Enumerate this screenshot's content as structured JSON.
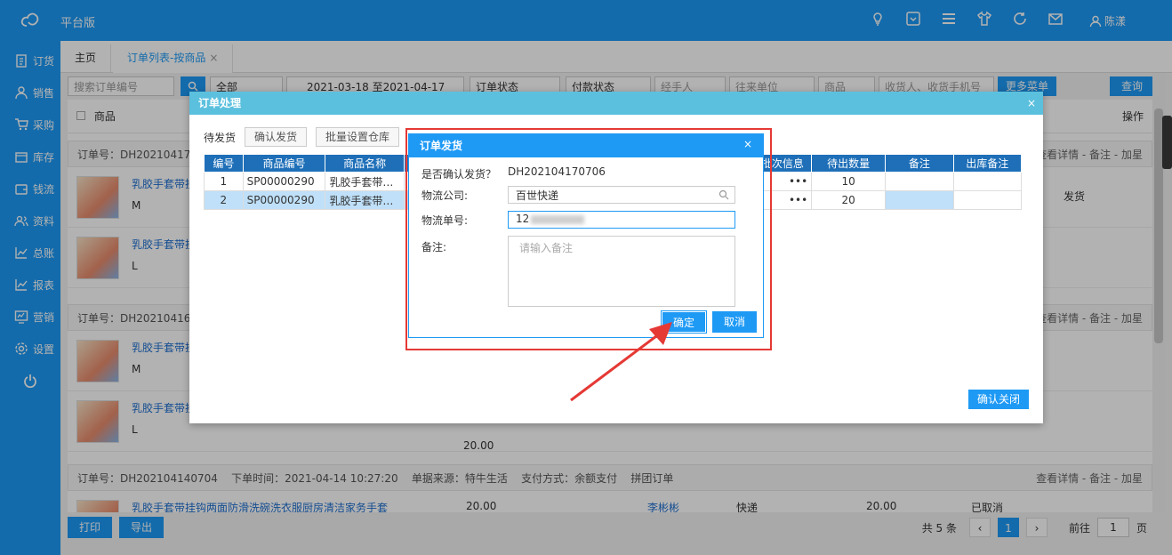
{
  "header": {
    "app_title": "平台版",
    "user_name": "陈漾",
    "icons": [
      "bulb-icon",
      "box-icon",
      "menu-icon",
      "shirt-icon",
      "refresh-icon",
      "mail-icon",
      "user-icon"
    ]
  },
  "sidebar": {
    "items": [
      {
        "label": "订货",
        "icon": "clipboard-icon"
      },
      {
        "label": "销售",
        "icon": "person-icon"
      },
      {
        "label": "采购",
        "icon": "cart-icon"
      },
      {
        "label": "库存",
        "icon": "store-icon"
      },
      {
        "label": "钱流",
        "icon": "wallet-icon"
      },
      {
        "label": "资料",
        "icon": "contacts-icon"
      },
      {
        "label": "总账",
        "icon": "chart-icon"
      },
      {
        "label": "报表",
        "icon": "chart-icon"
      },
      {
        "label": "营销",
        "icon": "monitor-icon"
      },
      {
        "label": "设置",
        "icon": "gear-icon"
      }
    ],
    "power_icon": "power-icon"
  },
  "tabs": {
    "home": "主页",
    "active": "订单列表-按商品",
    "close": "×"
  },
  "filter": {
    "search_placeholder": "搜索订单编号",
    "all": "全部",
    "date_start": "2021-03-18",
    "date_end": "至2021-04-17",
    "order_status": "订单状态",
    "pay_status": "付款状态",
    "handler": "经手人",
    "partner": "往来单位",
    "product": "商品",
    "receiver": "收货人、收货手机号",
    "more_menu": "更多菜单",
    "query": "查询"
  },
  "list": {
    "header_product": "商品",
    "header_action": "操作",
    "orders": [
      {
        "head": "订单号：DH20210417",
        "right": "查看详情 - 备注 - 加星",
        "products": [
          {
            "name": "乳胶手套带挂",
            "spec": "M",
            "status": "发货"
          },
          {
            "name": "乳胶手套带挂",
            "spec": "L",
            "status": ""
          }
        ]
      },
      {
        "head": "订单号：DH20210416",
        "right": "查看详情 - 备注 - 加星",
        "products": [
          {
            "name": "乳胶手套带挂",
            "spec": "M",
            "status": ""
          },
          {
            "name": "乳胶手套带挂",
            "spec": "L",
            "status": "",
            "price": "20.00"
          }
        ]
      },
      {
        "head": "订单号：DH202104140704    下单时间：2021-04-14 10:27:20    单据来源：特牛生活    支付方式：余额支付    拼团订单",
        "right": "查看详情 - 备注 - 加星",
        "products": [
          {
            "name": "乳胶手套带挂钩两面防滑洗碗洗衣服厨房清洁家务手套",
            "price": "20.00",
            "contact": "李彬彬",
            "ship": "快递",
            "amount": "20.00",
            "status": "已取消"
          }
        ]
      }
    ]
  },
  "bottom": {
    "print": "打印",
    "export": "导出",
    "total": "共 5 条",
    "current_page": "1",
    "goto": "前往",
    "page_input": "1",
    "page_unit": "页"
  },
  "dialog1": {
    "title": "订单处理",
    "close": "×",
    "tab_label": "待发货",
    "btn_confirm_ship": "确认发货",
    "btn_batch_warehouse": "批量设置仓库",
    "columns": [
      "编号",
      "商品编号",
      "商品名称",
      "商品",
      "",
      "",
      "",
      "",
      "批次信息",
      "待出数量",
      "备注",
      "出库备注"
    ],
    "rows": [
      {
        "no": "1",
        "code": "SP00000290",
        "name": "乳胶手套带…",
        "batch": "•••",
        "qty": "10"
      },
      {
        "no": "2",
        "code": "SP00000290",
        "name": "乳胶手套带…",
        "batch": "•••",
        "qty": "20"
      }
    ],
    "confirm_close": "确认关闭"
  },
  "dialog2": {
    "title": "订单发货",
    "close": "×",
    "confirm_label": "是否确认发货？",
    "order_no": "DH202104170706",
    "company_label": "物流公司:",
    "company_value": "百世快递",
    "tracking_label": "物流单号:",
    "tracking_value": "12",
    "note_label": "备注:",
    "note_placeholder": "请输入备注",
    "ok": "确定",
    "cancel": "取消"
  },
  "colors": {
    "primary": "#1e9af5",
    "dialog_header": "#5bc0de",
    "table_header": "#1e6fb8",
    "highlight": "#e53935"
  }
}
